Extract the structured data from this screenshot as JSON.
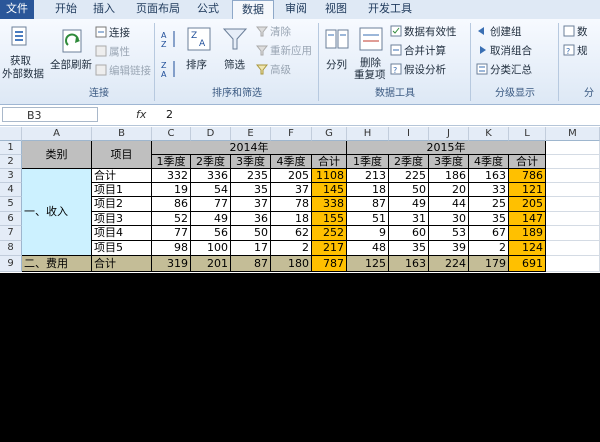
{
  "ribbon": {
    "tabs": [
      "文件",
      "开始",
      "插入",
      "页面布局",
      "公式",
      "数据",
      "审阅",
      "视图",
      "开发工具"
    ],
    "active_tab": "数据",
    "get_external": "获取",
    "get_external2": "外部数据",
    "refresh_all": "全部刷新",
    "connections": "连接",
    "properties": "属性",
    "edit_links": "编辑链接",
    "group_connections": "连接",
    "sort": "排序",
    "filter": "筛选",
    "clear": "清除",
    "reapply": "重新应用",
    "advanced": "高级",
    "group_sort_filter": "排序和筛选",
    "text_to_columns": "分列",
    "remove_duplicates": "删除",
    "remove_duplicates2": "重复项",
    "data_validation": "数据有效性",
    "consolidate": "合并计算",
    "what_if": "假设分析",
    "group_data_tools": "数据工具",
    "group_btn": "创建组",
    "ungroup_btn": "取消组合",
    "subtotal": "分类汇总",
    "group_outline": "分级显示",
    "right_cut1": "数",
    "right_cut2": "规",
    "right_cut3": "分"
  },
  "formula_bar": {
    "name_box": "B3",
    "fx": "fx",
    "value": "2"
  },
  "columns": [
    "A",
    "B",
    "C",
    "D",
    "E",
    "F",
    "G",
    "H",
    "I",
    "J",
    "K",
    "L",
    "M"
  ],
  "rows": [
    "1",
    "2",
    "3",
    "4",
    "5",
    "6",
    "7",
    "8",
    "9"
  ],
  "table": {
    "category_header": "类别",
    "item_header": "项目",
    "year1": "2014年",
    "year2": "2015年",
    "quarters": [
      "1季度",
      "2季度",
      "3季度",
      "4季度",
      "合计"
    ],
    "income_label": "一、收入",
    "expense_label": "二、费用",
    "income_rows": [
      {
        "name": "合计",
        "v": [
          "332",
          "336",
          "235",
          "205",
          "1108"
        ]
      },
      {
        "name": "项目1",
        "v": [
          "19",
          "54",
          "35",
          "37",
          "145"
        ]
      },
      {
        "name": "项目2",
        "v": [
          "86",
          "77",
          "37",
          "78",
          "338"
        ]
      },
      {
        "name": "项目3",
        "v": [
          "52",
          "49",
          "36",
          "18",
          "155"
        ]
      },
      {
        "name": "项目4",
        "v": [
          "77",
          "56",
          "50",
          "62",
          "252"
        ]
      },
      {
        "name": "项目5",
        "v": [
          "98",
          "100",
          "17",
          "2",
          "217"
        ]
      }
    ],
    "income_rows_2015": [
      [
        "213",
        "225",
        "186",
        "163",
        "786"
      ],
      [
        "18",
        "50",
        "20",
        "33",
        "121"
      ],
      [
        "87",
        "49",
        "44",
        "25",
        "205"
      ],
      [
        "51",
        "31",
        "30",
        "35",
        "147"
      ],
      [
        "9",
        "60",
        "53",
        "67",
        "189"
      ],
      [
        "48",
        "35",
        "39",
        "2",
        "124"
      ]
    ],
    "expense_total": {
      "name": "合计",
      "v": [
        "319",
        "201",
        "87",
        "180",
        "787"
      ],
      "v2": [
        "125",
        "163",
        "224",
        "179",
        "691"
      ]
    }
  }
}
